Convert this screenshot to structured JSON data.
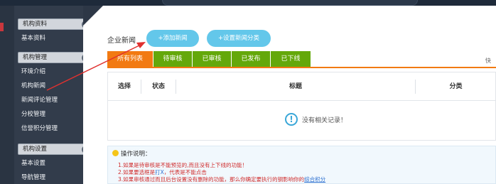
{
  "colors": {
    "accent_orange": "#f27a12",
    "tab_green": "#64a80a",
    "pill_blue": "#63c7ea",
    "sidebar_bg": "#323c4b",
    "annotation_arrow": "#e0312f"
  },
  "sidebar": {
    "groups": [
      {
        "title": "机构资料",
        "toggle": "−",
        "items": [
          "基本资料"
        ]
      },
      {
        "title": "机构管理",
        "toggle": "−",
        "items": [
          "环境介绍",
          "机构新闻",
          "新闻评论管理",
          "分校管理",
          "信誉积分管理"
        ]
      },
      {
        "title": "机构设置",
        "toggle": "−",
        "items": [
          "基本设置",
          "导航管理"
        ]
      }
    ]
  },
  "header": {
    "title": "企业新闻",
    "add_button": "+添加新闻",
    "category_button": "+设置新闻分类",
    "quick": "快"
  },
  "tabs": [
    {
      "label": "所有列表",
      "active": true
    },
    {
      "label": "待审核",
      "active": false
    },
    {
      "label": "已审核",
      "active": false
    },
    {
      "label": "已发布",
      "active": false
    },
    {
      "label": "已下线",
      "active": false
    }
  ],
  "table": {
    "columns": [
      "选择",
      "状态",
      "标题",
      "分类"
    ],
    "empty_icon": "!",
    "empty_text": "没有相关记录！"
  },
  "notes": {
    "title": "操作说明：",
    "line1": "1.如果是待审核是不能预览的,而且没有上下线的功能！",
    "line2_pre": "2.如果要选框是",
    "line2_mark": "打X",
    "line2_post": "，代表是不能点击",
    "line3_pre": "3.如果审核通过而且后台设置没有删除的功能，那么你确定要执行的钢影响你的",
    "line3_link": "综合积分"
  }
}
